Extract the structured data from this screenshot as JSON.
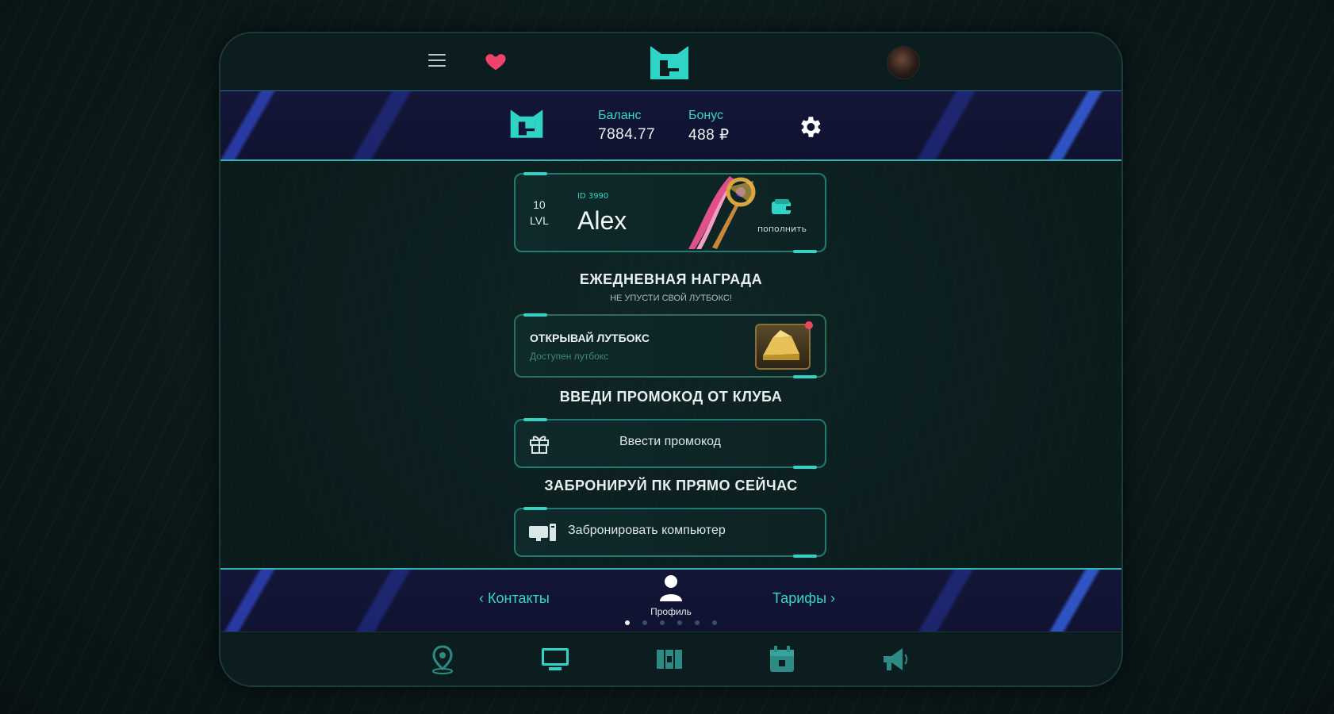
{
  "header": {
    "menu_icon": "hamburger-icon",
    "favorite_icon": "heart-icon",
    "logo_icon": "club-logo-icon",
    "avatar": "user-avatar"
  },
  "account": {
    "balance_label": "Баланс",
    "balance_value": "7884.77",
    "bonus_label": "Бонус",
    "bonus_value": "488 ₽",
    "settings_icon": "gear-icon"
  },
  "profile": {
    "level_number": "10",
    "level_label": "LVL",
    "user_id": "ID 3990",
    "name": "Alex",
    "topup_label": "пополнить",
    "topup_icon": "wallet-icon"
  },
  "daily_reward": {
    "title": "ЕЖЕДНЕВНАЯ НАГРАДА",
    "subtitle": "НЕ УПУСТИ СВОЙ ЛУТБОКС!",
    "card_title": "ОТКРЫВАЙ ЛУТБОКС",
    "card_sub": "Доступен лутбокс",
    "chest_icon": "treasure-chest-icon"
  },
  "promo": {
    "title": "ВВЕДИ ПРОМОКОД ОТ КЛУБА",
    "button_label": "Ввести промокод",
    "icon": "gift-icon"
  },
  "booking": {
    "title": "ЗАБРОНИРУЙ ПК ПРЯМО СЕЙЧАС",
    "button_label": "Забронировать компьютер",
    "icon": "computer-icon"
  },
  "carousel": {
    "prev_label": "Контакты",
    "center_label": "Профиль",
    "next_label": "Тарифы",
    "pages": 6,
    "active_page": 1
  },
  "tabs": [
    {
      "name": "location",
      "icon": "location-pin-icon"
    },
    {
      "name": "computers",
      "icon": "monitor-icon"
    },
    {
      "name": "map",
      "icon": "map-icon"
    },
    {
      "name": "calendar",
      "icon": "calendar-icon"
    },
    {
      "name": "news",
      "icon": "megaphone-icon"
    }
  ],
  "colors": {
    "accent": "#35d6c8",
    "background": "#0b1d1e",
    "banner": "#141638",
    "heart": "#f0436c",
    "notification": "#e84a5c"
  }
}
